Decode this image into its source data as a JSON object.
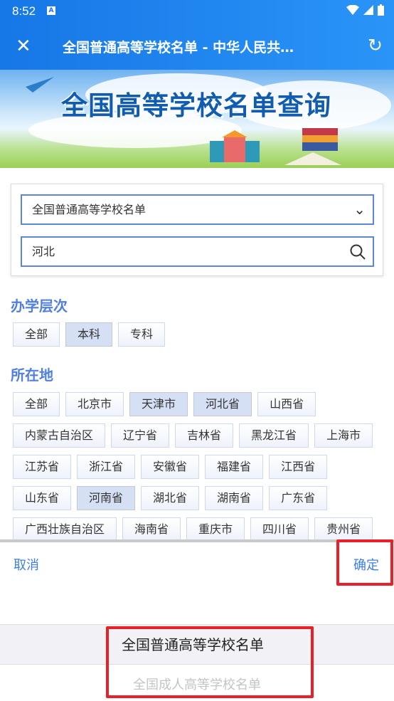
{
  "status_bar": {
    "time": "8:52",
    "notification_icon": "A"
  },
  "toolbar": {
    "title": "全国普通高等学校名单 - 中华人民共…",
    "close_icon": "close-icon",
    "reload_icon": "reload-icon"
  },
  "banner": {
    "title": "全国高等学校名单查询"
  },
  "form": {
    "list_select_value": "全国普通高等学校名单",
    "search_value": "河北"
  },
  "level": {
    "heading": "办学层次",
    "options": [
      {
        "label": "全部",
        "selected": false
      },
      {
        "label": "本科",
        "selected": true
      },
      {
        "label": "专科",
        "selected": false
      }
    ]
  },
  "location": {
    "heading": "所在地",
    "options": [
      {
        "label": "全部"
      },
      {
        "label": "北京市"
      },
      {
        "label": "天津市",
        "selected": true
      },
      {
        "label": "河北省",
        "selected": true
      },
      {
        "label": "山西省"
      },
      {
        "label": "内蒙古自治区"
      },
      {
        "label": "辽宁省"
      },
      {
        "label": "吉林省"
      },
      {
        "label": "黑龙江省"
      },
      {
        "label": "上海市"
      },
      {
        "label": "江苏省"
      },
      {
        "label": "浙江省"
      },
      {
        "label": "安徽省"
      },
      {
        "label": "福建省"
      },
      {
        "label": "江西省"
      },
      {
        "label": "山东省"
      },
      {
        "label": "河南省",
        "selected": true
      },
      {
        "label": "湖北省"
      },
      {
        "label": "湖南省"
      },
      {
        "label": "广东省"
      },
      {
        "label": "广西壮族自治区"
      },
      {
        "label": "海南省"
      },
      {
        "label": "重庆市"
      },
      {
        "label": "四川省"
      },
      {
        "label": "贵州省"
      }
    ]
  },
  "picker": {
    "cancel": "取消",
    "confirm": "确定",
    "options": [
      "全国普通高等学校名单",
      "全国成人高等学校名单"
    ],
    "selected_index": 0
  },
  "colors": {
    "accent": "#3d7de8",
    "toolbar": "#1677e6",
    "highlight": "#e8202a"
  }
}
